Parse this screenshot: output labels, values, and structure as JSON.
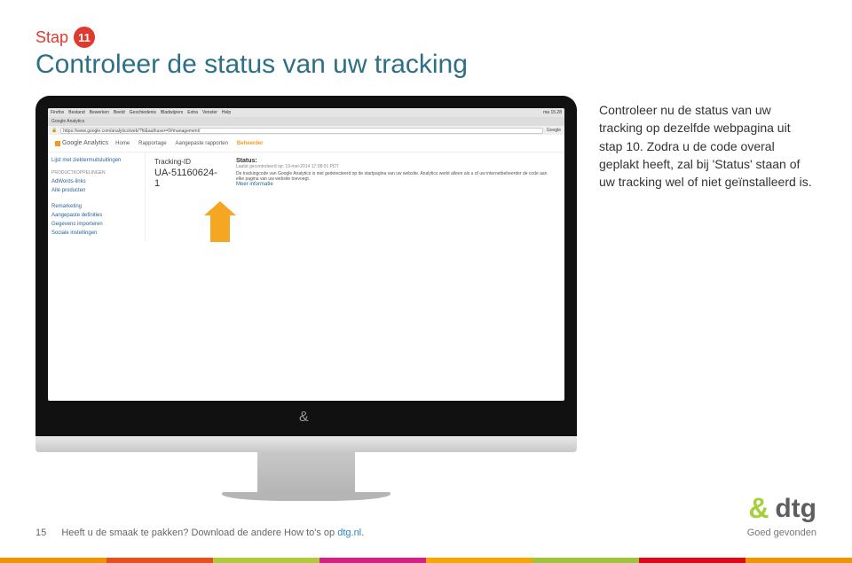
{
  "step": {
    "label": "Stap",
    "number": "11"
  },
  "heading": "Controleer de status van uw tracking",
  "description": "Controleer nu de status van uw tracking op dezelfde webpagina uit stap 10. Zodra u de code overal geplakt heeft, zal bij 'Status' staan of uw tracking wel of niet geïnstalleerd is.",
  "browser": {
    "menubar": [
      "Firefox",
      "Bestand",
      "Bewerken",
      "Beeld",
      "Geschiedenis",
      "Bladwijzers",
      "Extra",
      "Venster",
      "Help"
    ],
    "time": "ma 15.28",
    "tab": "Google Analytics",
    "url": "https://www.google.com/analytics/web/?hl&authuser=0#management/",
    "search_engine": "Google"
  },
  "ga": {
    "brand": "Google Analytics",
    "nav": {
      "home": "Home",
      "reporting": "Rapportage",
      "custom": "Aangepaste rapporten",
      "admin": "Beheerder"
    },
    "sidebar": {
      "list_title": "Lijst met ziektermuitsluitingen",
      "sec1": "PRODUCTKOPPELINGEN",
      "adwords": "AdWords-links",
      "all_products": "Alle producten",
      "remarketing": "Remarketing",
      "custom_defs": "Aangepaste definities",
      "data_import": "Gegevens importeren",
      "social": "Sociale instellingen"
    },
    "main": {
      "tracking_label": "Tracking-ID",
      "tracking_id": "UA-51160624-1",
      "status_label": "Status:",
      "status_sub": "Laatst gecontroleerd op: 19-mei-2014 17:08:01 PDT",
      "status_desc": "De trackingcode van Google Analytics is niet gedetecteerd op de startpagina van uw website. Analytics werkt alleen als u of uw internetbeheerder de code aan elke pagina van uw website toevoegt.",
      "more_info": "Meer informatie"
    }
  },
  "footer": {
    "page": "15",
    "question": "Heeft u de smaak te pakken? Download de andere How to's op ",
    "link_text": "dtg.nl",
    "tagline": "Goed gevonden",
    "brand": "dtg"
  }
}
